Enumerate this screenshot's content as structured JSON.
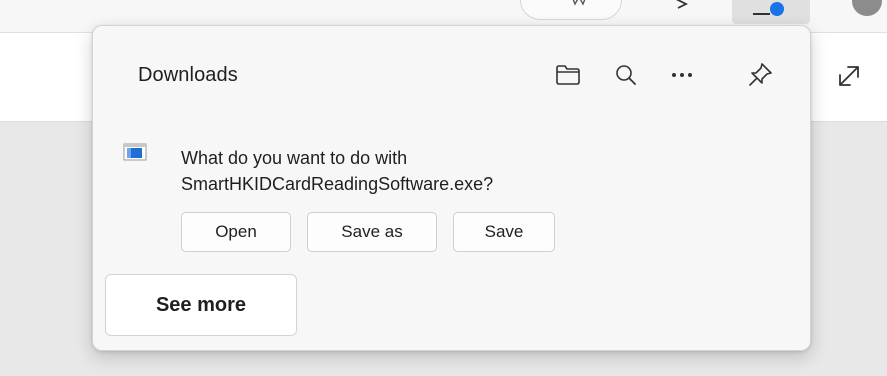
{
  "window": {
    "colors": {
      "badge": "#1a73e8",
      "panel": "#f7f7f7",
      "text": "#1f1f1f"
    }
  },
  "toolbar": {
    "icons": [
      "favorite-icon",
      "share-icon",
      "downloads-icon",
      "profile-icon",
      "expand-icon"
    ]
  },
  "downloads": {
    "title": "Downloads",
    "header_icons": [
      "folder-icon",
      "search-icon",
      "more-icon",
      "pin-icon"
    ],
    "item": {
      "icon": "executable-file-icon",
      "prompt_line1": "What do you want to do with",
      "prompt_line2": "SmartHKIDCardReadingSoftware.exe?"
    },
    "actions": {
      "open": "Open",
      "save_as": "Save as",
      "save": "Save"
    },
    "see_more": "See more"
  }
}
